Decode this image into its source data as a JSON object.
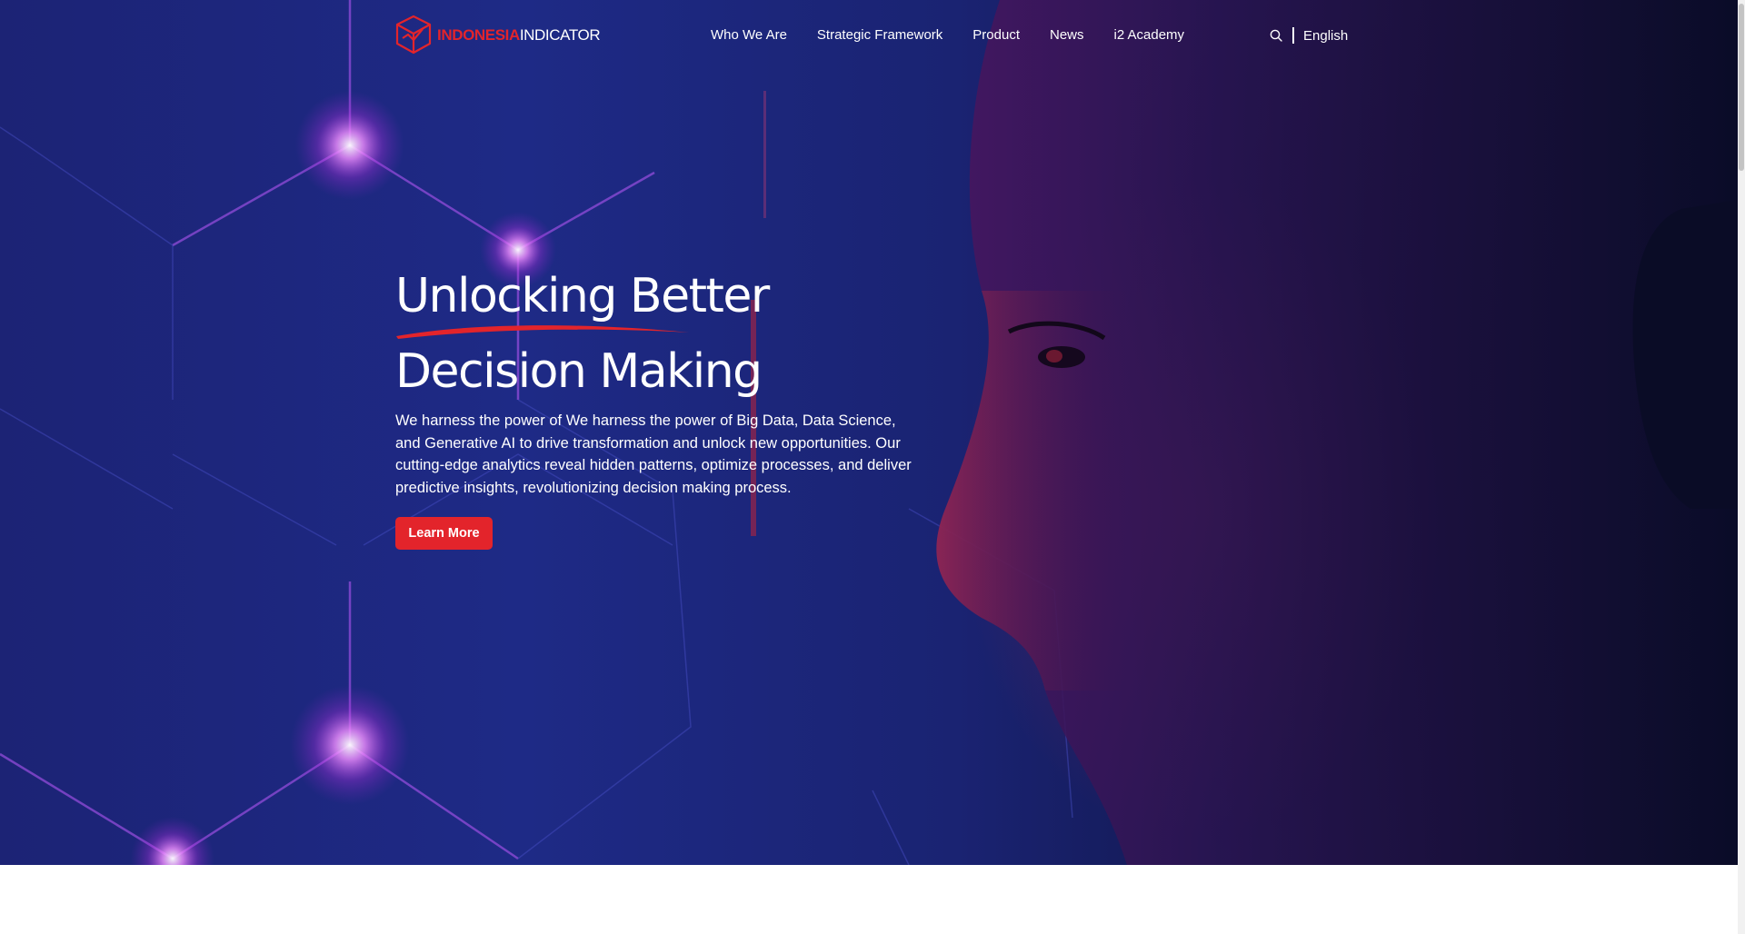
{
  "header": {
    "logo": {
      "part1": "INDONESIA",
      "part2": "INDICATOR"
    },
    "nav": [
      {
        "label": "Who We Are"
      },
      {
        "label": "Strategic Framework"
      },
      {
        "label": "Product"
      },
      {
        "label": "News"
      },
      {
        "label": "i2 Academy"
      }
    ],
    "search_icon": "search-icon",
    "language": "English"
  },
  "hero": {
    "title_line1": "Unlocking Better",
    "title_line2": "Decision Making",
    "description": "We harness the power of We harness the power of Big Data, Data Science, and Generative AI to drive transformation and unlock new opportunities. Our cutting-edge analytics reveal hidden patterns, optimize processes, and deliver predictive insights, revolutionizing decision making process.",
    "cta_label": "Learn More"
  },
  "colors": {
    "accent": "#e3242b",
    "hero_navy": "#1e2a86",
    "hero_glow": "#e048ff",
    "text_on_dark": "#ffffff"
  }
}
